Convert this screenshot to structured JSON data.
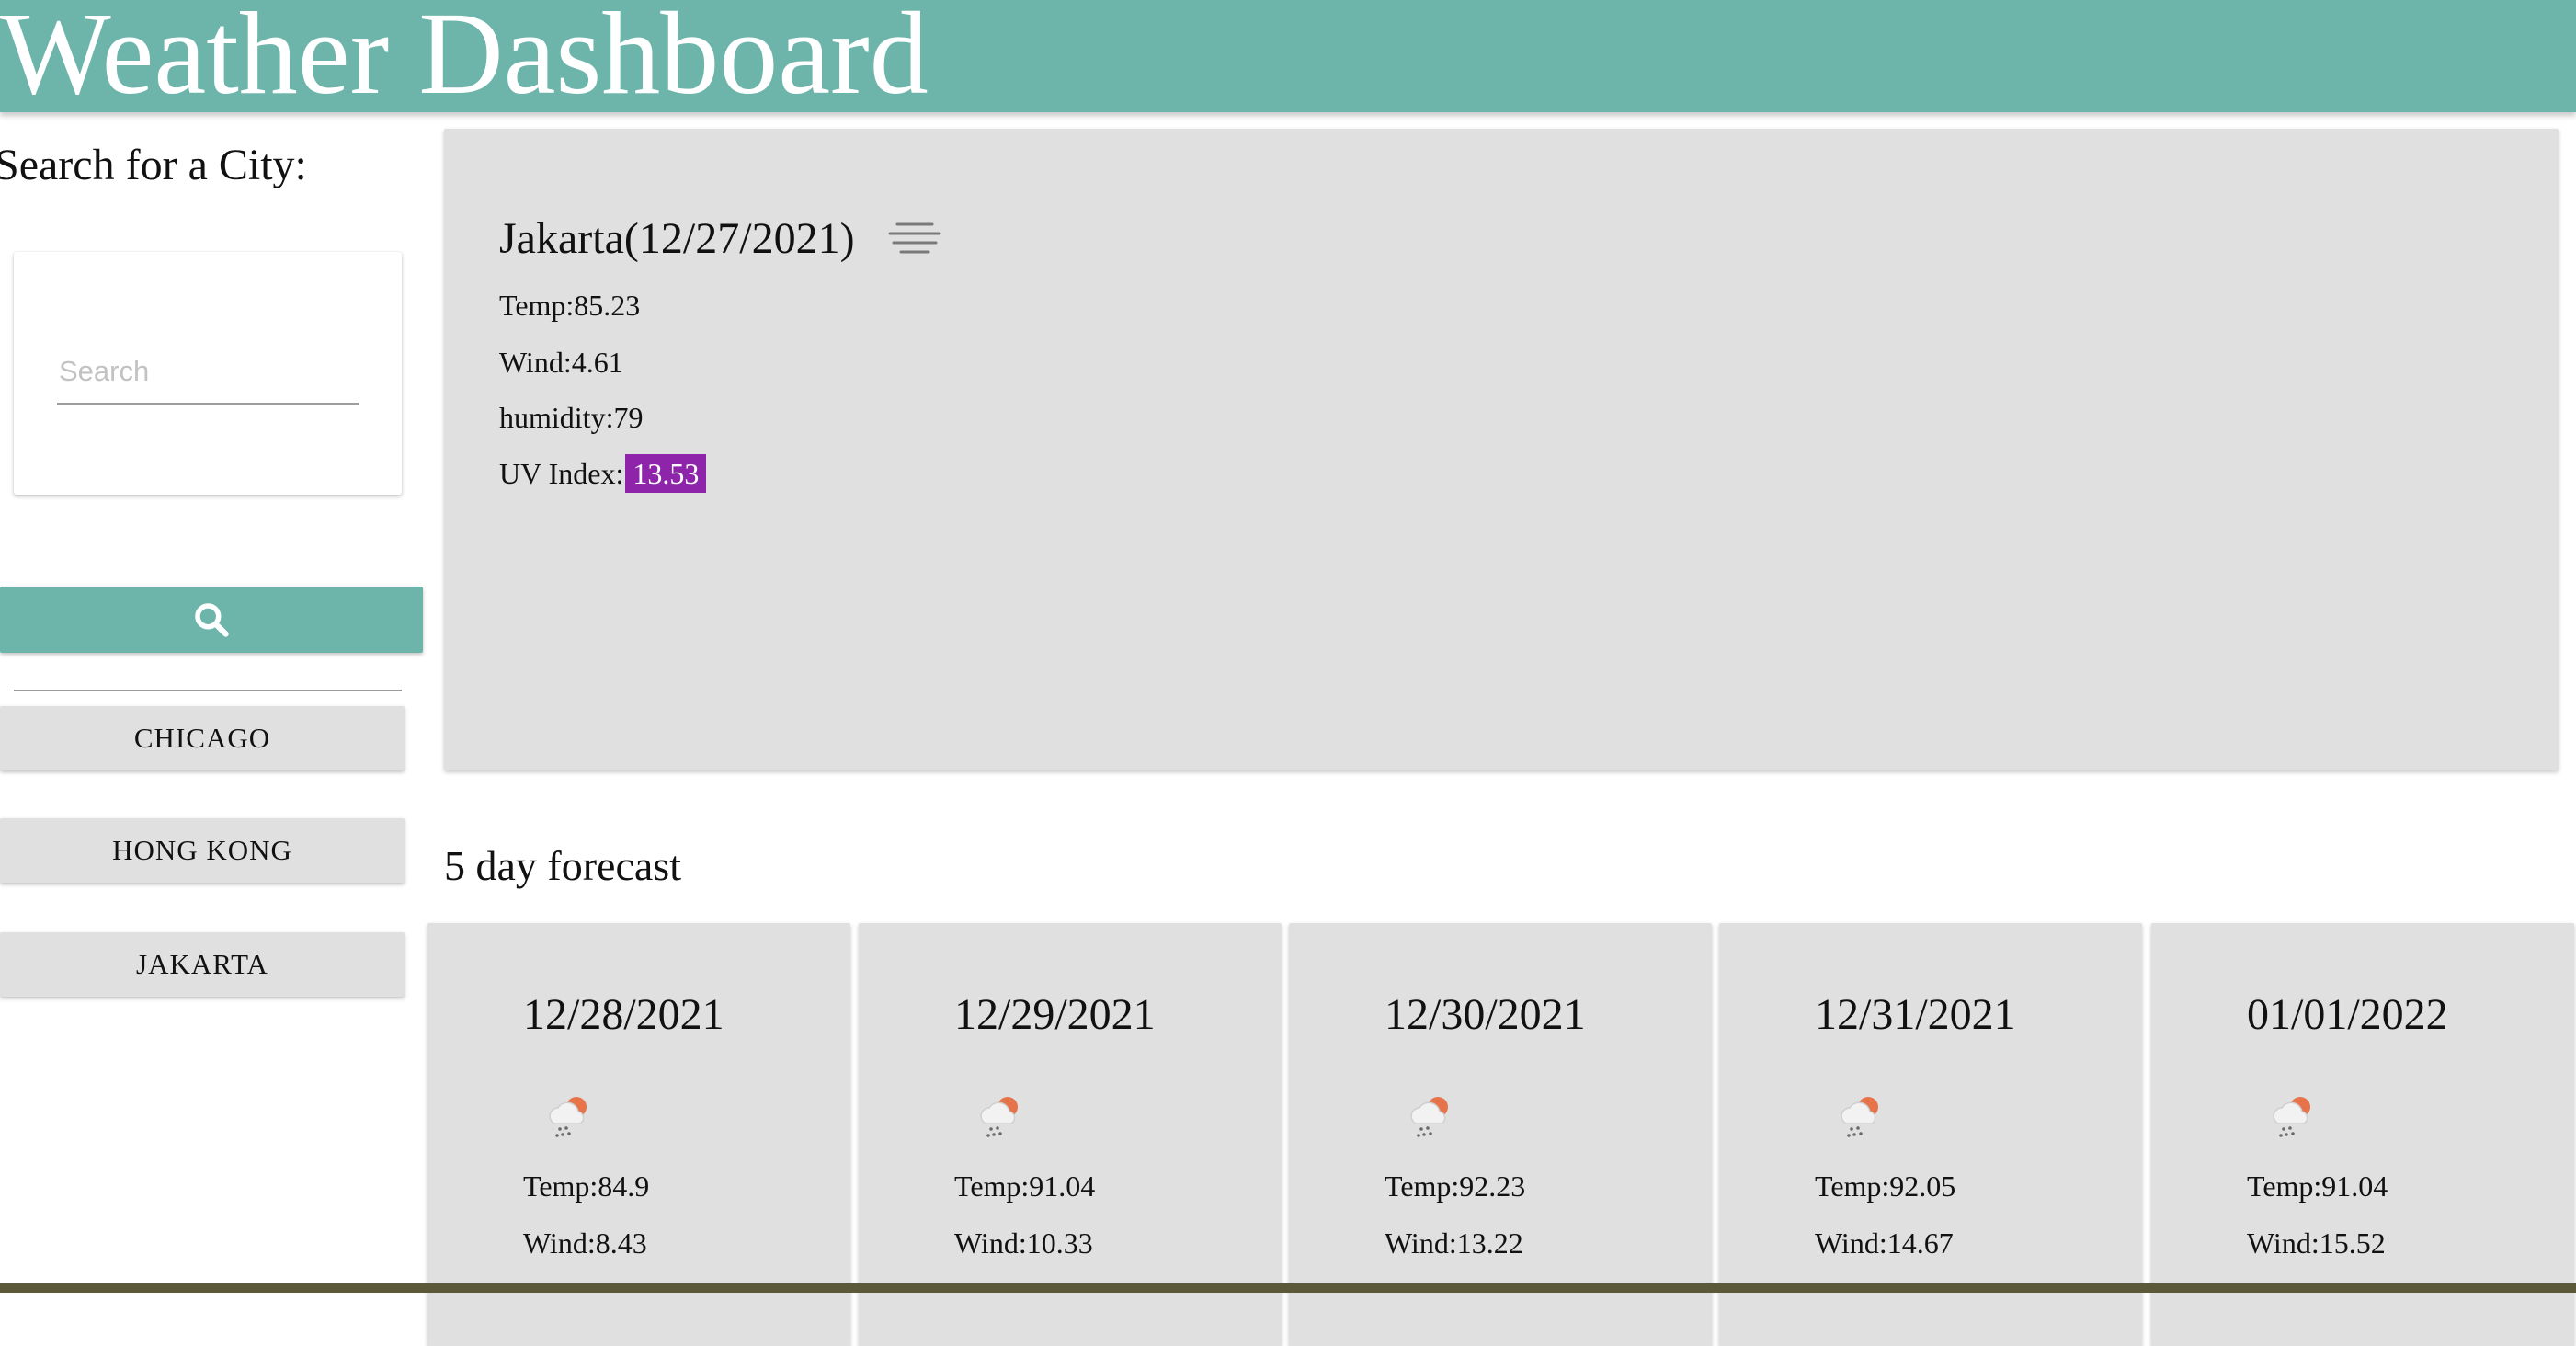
{
  "header": {
    "title": "Weather Dashboard"
  },
  "sidebar": {
    "search_heading": "Search for a City:",
    "search_placeholder": "Search",
    "search_value": "",
    "search_button_icon": "search-icon",
    "history": [
      {
        "label": "CHICAGO"
      },
      {
        "label": "HONG KONG"
      },
      {
        "label": "JAKARTA"
      }
    ]
  },
  "current": {
    "city": "Jakarta",
    "date": "(12/27/2021)",
    "icon": "mist-icon",
    "temp_label": "Temp:",
    "temp": "85.23",
    "wind_label": "Wind:",
    "wind": "4.61",
    "humidity_label": "humidity:",
    "humidity": "79",
    "uv_label": "UV Index:",
    "uv": "13.53"
  },
  "forecast": {
    "heading": "5 day forecast",
    "days": [
      {
        "date": "12/28/2021",
        "icon": "light-rain-icon",
        "temp_label": "Temp:",
        "temp": "84.9",
        "wind_label": "Wind:",
        "wind": "8.43"
      },
      {
        "date": "12/29/2021",
        "icon": "light-rain-icon",
        "temp_label": "Temp:",
        "temp": "91.04",
        "wind_label": "Wind:",
        "wind": "10.33"
      },
      {
        "date": "12/30/2021",
        "icon": "light-rain-icon",
        "temp_label": "Temp:",
        "temp": "92.23",
        "wind_label": "Wind:",
        "wind": "13.22"
      },
      {
        "date": "12/31/2021",
        "icon": "light-rain-icon",
        "temp_label": "Temp:",
        "temp": "92.05",
        "wind_label": "Wind:",
        "wind": "14.67"
      },
      {
        "date": "01/01/2022",
        "icon": "light-rain-icon",
        "temp_label": "Temp:",
        "temp": "91.04",
        "wind_label": "Wind:",
        "wind": "15.52"
      }
    ]
  },
  "colors": {
    "header": "#6db5ab",
    "search_button": "#6db5ab",
    "card_background": "#e0e0e0",
    "uv_badge": "#8e24aa",
    "history_button": "#e0e0e0"
  }
}
